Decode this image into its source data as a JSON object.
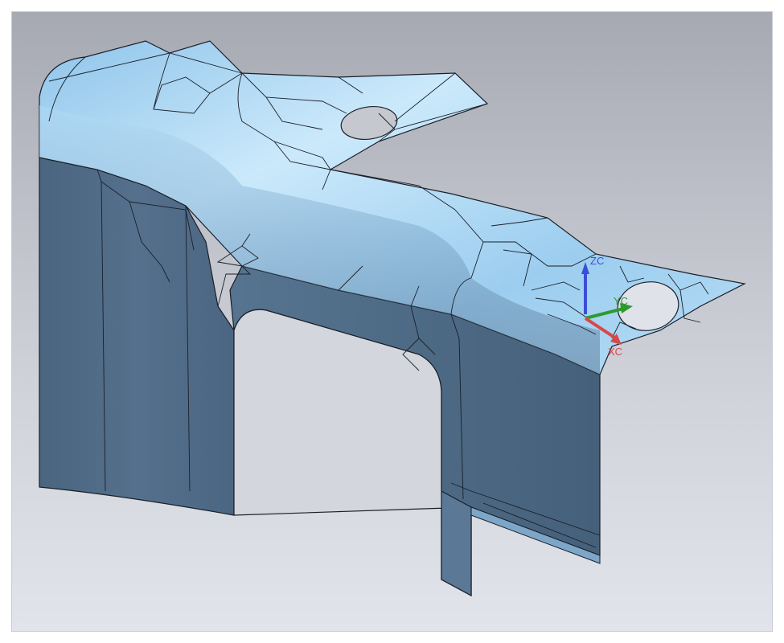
{
  "viewport": {
    "background_top": "#a6a9b2",
    "background_bottom": "#e2e4ec"
  },
  "model": {
    "top_surface_color": "#a9d4f0",
    "side_surface_color": "#4f6a84",
    "edge_color": "#1a1f27"
  },
  "triad": {
    "zc_label": "ZC",
    "yc_label": "YC",
    "xc_label": "XC",
    "zc_color": "#3a4fd6",
    "yc_color": "#2e9a2e",
    "xc_color": "#d84848"
  }
}
